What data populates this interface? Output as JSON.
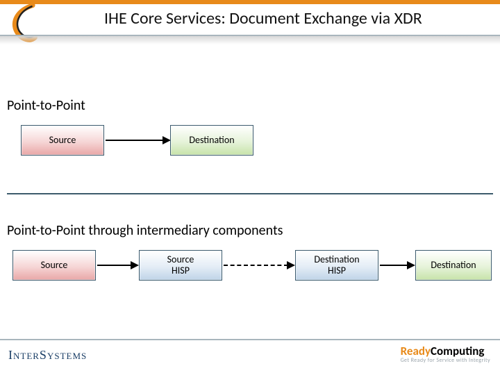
{
  "title": "IHE Core Services:  Document Exchange via XDR",
  "section1": "Point-to-Point",
  "section2": "Point-to-Point through intermediary components",
  "row1": {
    "source": "Source",
    "dest": "Destination"
  },
  "row2": {
    "source": "Source",
    "srcHisp": "Source\nHISP",
    "dstHisp": "Destination\nHISP",
    "dest": "Destination"
  },
  "footer": {
    "intersystems": "InterSystems",
    "ready_a": "Ready",
    "ready_b": "Computing",
    "ready_tag": "Get Ready for Service with Integrity"
  }
}
